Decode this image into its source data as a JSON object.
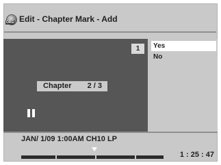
{
  "header": {
    "icon_label": "ORG",
    "icon_name": "original-disc-icon",
    "title": "Edit - Chapter Mark - Add"
  },
  "video": {
    "counter": "1",
    "chapter_label": "Chapter",
    "chapter_value": "2 / 3",
    "playback_icon": "pause-icon"
  },
  "menu": {
    "items": [
      {
        "label": "Yes",
        "selected": true
      },
      {
        "label": "No",
        "selected": false
      }
    ]
  },
  "status": {
    "info": "JAN/ 1/09 1:00AM CH10   LP",
    "time": "1 : 25 : 47"
  },
  "colors": {
    "panel": "#c9c9c9",
    "video_bg": "#565656",
    "selected_bg": "#ffffff"
  }
}
